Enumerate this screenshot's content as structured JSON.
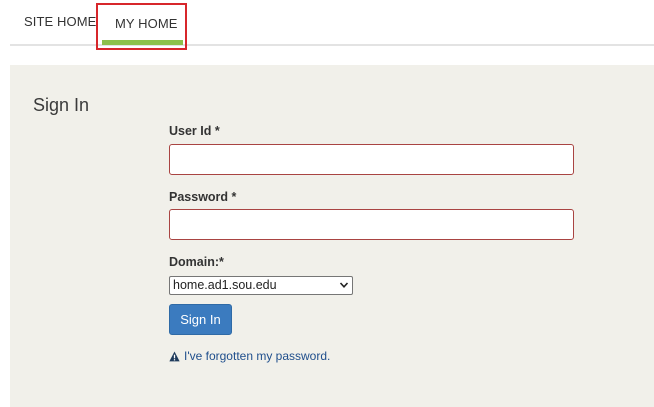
{
  "nav": {
    "tabs": [
      {
        "label": "SITE HOME",
        "active": false
      },
      {
        "label": "MY HOME",
        "active": true
      }
    ],
    "active_color": "#8cc04b",
    "highlight_color": "#d7262b"
  },
  "signin": {
    "title": "Sign In",
    "userid_label": "User Id *",
    "userid_value": "",
    "password_label": "Password *",
    "password_value": "",
    "domain_label": "Domain:*",
    "domain_selected": "home.ad1.sou.edu",
    "button_label": "Sign In",
    "forgot_label": "I've forgotten my password.",
    "forgot_icon": "warning-icon",
    "button_color": "#3b7bbf",
    "invalid_border_color": "#a94442"
  }
}
